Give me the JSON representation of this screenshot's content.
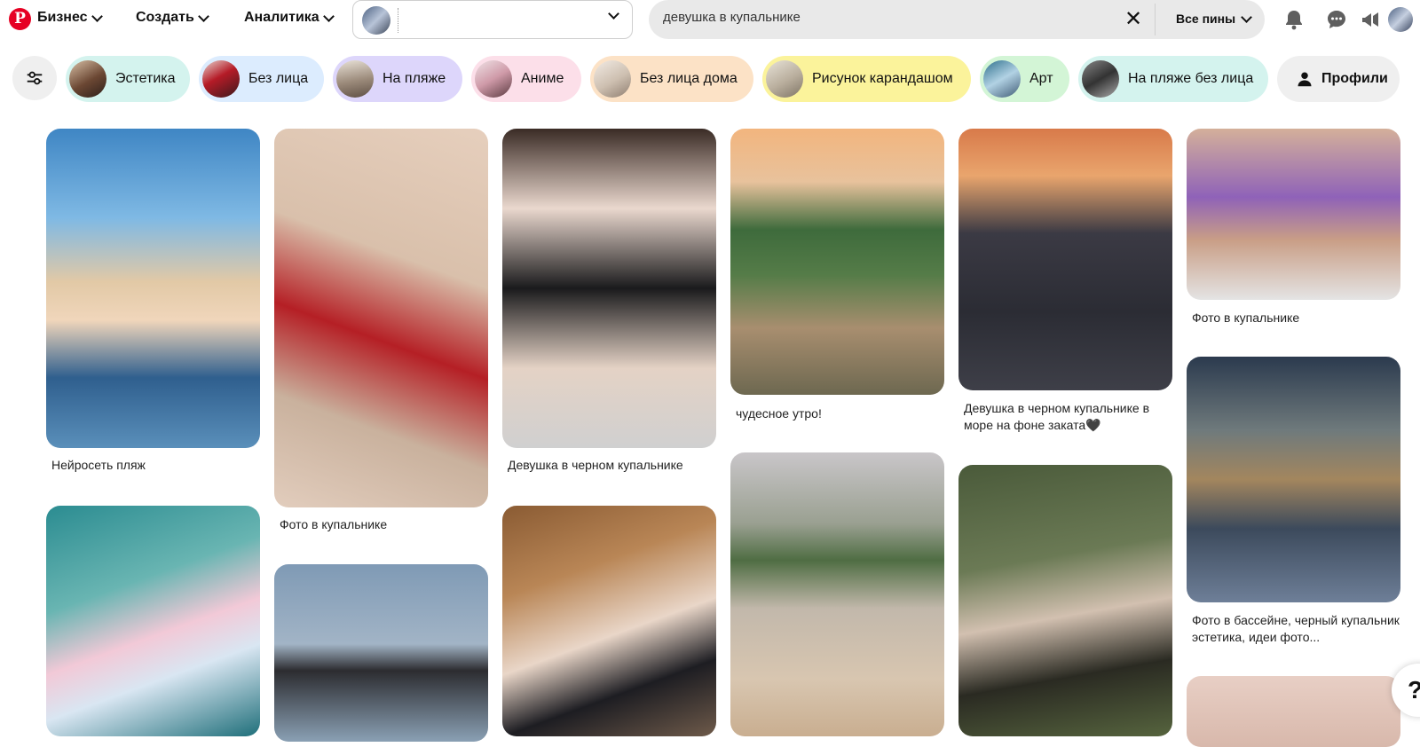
{
  "nav": {
    "business": "Бизнес",
    "create": "Создать",
    "analytics": "Аналитика"
  },
  "search": {
    "value": "девушка в купальнике",
    "filter": "Все пины"
  },
  "chips": [
    {
      "label": "Эстетика",
      "bg": "#d4f3ee"
    },
    {
      "label": "Без лица",
      "bg": "#dcecfe"
    },
    {
      "label": "На пляже",
      "bg": "#ddd6fb"
    },
    {
      "label": "Аниме",
      "bg": "#fcdfe9"
    },
    {
      "label": "Без лица дома",
      "bg": "#fce2c6"
    },
    {
      "label": "Рисунок карандашом",
      "bg": "#fbf39b"
    },
    {
      "label": "Арт",
      "bg": "#d3f5d6"
    },
    {
      "label": "На пляже без лица",
      "bg": "#d4f3ee"
    }
  ],
  "profiles_label": "Профили",
  "pins": [
    {
      "caption": "Нейросеть пляж"
    },
    {
      "caption": "Фото в купальнике"
    },
    {
      "caption": "Девушка в черном купальнике"
    },
    {
      "caption": "чудесное утро!"
    },
    {
      "caption": "Девушка в черном купальнике в море на фоне заката🖤"
    },
    {
      "caption": "Фото в купальнике"
    },
    {
      "caption": "Фото в бассейне, черный купальник эстетика, идеи фото..."
    }
  ],
  "help_label": "?",
  "colors": {
    "brand": "#e60023",
    "search_bg": "#e9e9e9"
  },
  "icons": [
    "pinterest-logo-icon",
    "bell-icon",
    "chat-icon",
    "megaphone-icon",
    "settings-sliders-icon",
    "person-icon",
    "close-icon",
    "chevron-down-icon"
  ]
}
